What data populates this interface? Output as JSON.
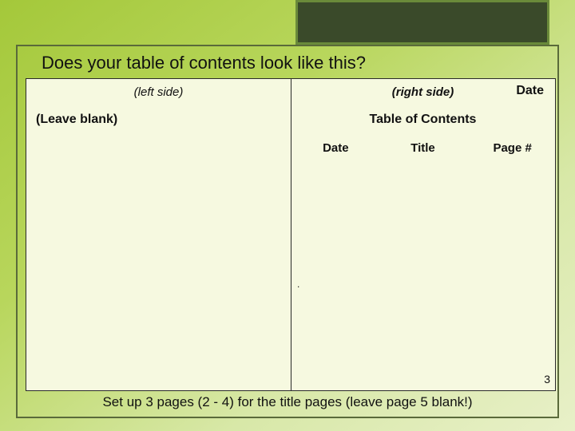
{
  "title": "Does your table of contents look like this?",
  "left": {
    "label": "(left side)",
    "leave_blank": "(Leave blank)"
  },
  "right": {
    "label": "(right side)",
    "date_top": "Date",
    "toc_title": "Table of Contents",
    "columns": {
      "date": "Date",
      "title": "Title",
      "page": "Page #"
    },
    "page_number": "3"
  },
  "dot": ".",
  "footer": "Set up 3 pages (2 - 4) for the title pages (leave page 5 blank!)"
}
